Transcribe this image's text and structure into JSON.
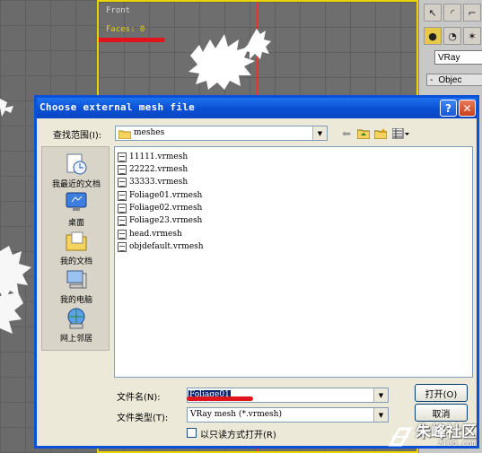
{
  "viewport": {
    "label": "Front",
    "faces": "Faces: 0"
  },
  "side_panel": {
    "renderer": "VRay",
    "object_type": "Objec"
  },
  "dialog": {
    "title": "Choose external mesh file",
    "look_in_label": "查找范围(I):",
    "look_in_value": "meshes",
    "places": [
      {
        "label": "我最近的文档",
        "icon": "recent-documents-icon"
      },
      {
        "label": "桌面",
        "icon": "desktop-icon"
      },
      {
        "label": "我的文档",
        "icon": "my-documents-icon"
      },
      {
        "label": "我的电脑",
        "icon": "my-computer-icon"
      },
      {
        "label": "网上邻居",
        "icon": "network-places-icon"
      }
    ],
    "files": [
      "11111.vrmesh",
      "22222.vrmesh",
      "33333.vrmesh",
      "Foliage01.vrmesh",
      "Foliage02.vrmesh",
      "Foliage23.vrmesh",
      "head.vrmesh",
      "objdefault.vrmesh"
    ],
    "filename_label": "文件名(N):",
    "filename_value": "Foliage01",
    "filetype_label": "文件类型(T):",
    "filetype_value": "VRay mesh (*.vrmesh)",
    "open_button": "打开(O)",
    "cancel_button": "取消",
    "readonly_label": "以只读方式打开(R)"
  },
  "watermark": {
    "text": "朱峰社区",
    "url": "zf3d.com"
  },
  "colors": {
    "title_bar": "#0a50d8",
    "highlight": "#0a246a",
    "annotation": "#e0141b",
    "viewport_border": "#e8d400"
  }
}
